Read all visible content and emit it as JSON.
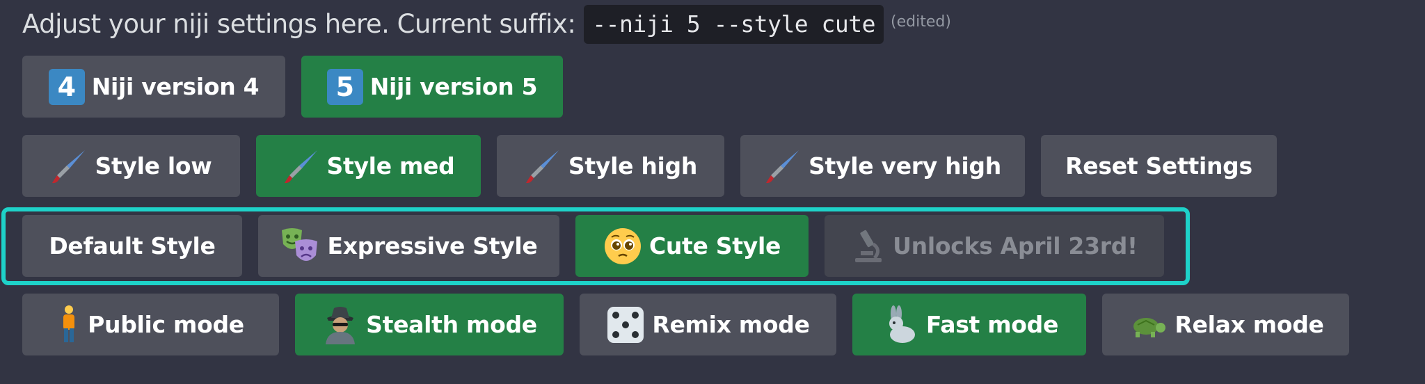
{
  "message": {
    "text": "Adjust your niji settings here. Current suffix:",
    "suffix_code": "--niji 5 --style cute",
    "edited_label": "(edited)"
  },
  "rows": {
    "version": [
      {
        "label": "Niji version 4",
        "icon": "keycap-4-icon",
        "icon_text": "4",
        "state": "default"
      },
      {
        "label": "Niji version 5",
        "icon": "keycap-5-icon",
        "icon_text": "5",
        "state": "selected"
      }
    ],
    "stylize": [
      {
        "label": "Style low",
        "icon": "paintbrush-icon",
        "state": "default"
      },
      {
        "label": "Style med",
        "icon": "paintbrush-icon",
        "state": "selected"
      },
      {
        "label": "Style high",
        "icon": "paintbrush-icon",
        "state": "default"
      },
      {
        "label": "Style very high",
        "icon": "paintbrush-icon",
        "state": "default"
      },
      {
        "label": "Reset Settings",
        "icon": "",
        "state": "default"
      }
    ],
    "style": [
      {
        "label": "Default Style",
        "icon": "",
        "state": "default"
      },
      {
        "label": "Expressive Style",
        "icon": "theater-masks-icon",
        "state": "default"
      },
      {
        "label": "Cute Style",
        "icon": "pleading-face-icon",
        "state": "selected"
      },
      {
        "label": "Unlocks April 23rd!",
        "icon": "microscope-icon",
        "state": "disabled"
      }
    ],
    "mode": [
      {
        "label": "Public mode",
        "icon": "person-standing-icon",
        "state": "default"
      },
      {
        "label": "Stealth mode",
        "icon": "spy-icon",
        "state": "selected"
      },
      {
        "label": "Remix mode",
        "icon": "dice-icon",
        "state": "default"
      },
      {
        "label": "Fast mode",
        "icon": "rabbit-icon",
        "state": "selected"
      },
      {
        "label": "Relax mode",
        "icon": "turtle-icon",
        "state": "default"
      }
    ]
  },
  "colors": {
    "background": "#323443",
    "button_default": "#4e505b",
    "button_selected": "#248046",
    "button_disabled": "#43454f",
    "highlight_outline": "#1ed2c9"
  }
}
